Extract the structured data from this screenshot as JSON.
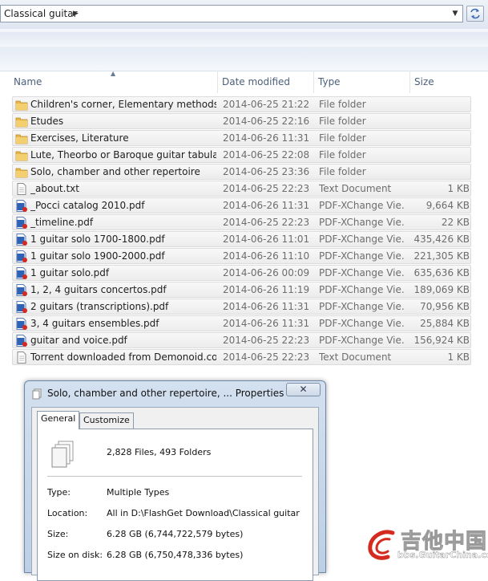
{
  "address_bar": {
    "path": "Classical guitar",
    "chevron_icon": "chevron-right-icon",
    "dropdown_icon": "chevron-down-icon",
    "refresh_icon": "refresh-icon"
  },
  "columns": {
    "name": "Name",
    "date_modified": "Date modified",
    "type": "Type",
    "size": "Size",
    "sorted_by": "Name"
  },
  "files": [
    {
      "name": "Children's corner, Elementary methods",
      "date": "2014-06-25 21:22",
      "type": "File folder",
      "size": "",
      "icon": "folder-icon"
    },
    {
      "name": "Etudes",
      "date": "2014-06-25 22:16",
      "type": "File folder",
      "size": "",
      "icon": "folder-icon"
    },
    {
      "name": "Exercises, Literature",
      "date": "2014-06-26 11:31",
      "type": "File folder",
      "size": "",
      "icon": "folder-icon"
    },
    {
      "name": "Lute, Theorbo or Baroque guitar tabulatu...",
      "date": "2014-06-25 22:08",
      "type": "File folder",
      "size": "",
      "icon": "folder-icon"
    },
    {
      "name": "Solo, chamber and other repertoire",
      "date": "2014-06-25 23:36",
      "type": "File folder",
      "size": "",
      "icon": "folder-icon"
    },
    {
      "name": "_about.txt",
      "date": "2014-06-25 22:23",
      "type": "Text Document",
      "size": "1 KB",
      "icon": "text-file-icon"
    },
    {
      "name": "_Pocci catalog 2010.pdf",
      "date": "2014-06-26 11:31",
      "type": "PDF-XChange Vie...",
      "size": "9,664 KB",
      "icon": "pdf-file-icon"
    },
    {
      "name": "_timeline.pdf",
      "date": "2014-06-25 22:23",
      "type": "PDF-XChange Vie...",
      "size": "22 KB",
      "icon": "pdf-file-icon"
    },
    {
      "name": "1 guitar solo 1700-1800.pdf",
      "date": "2014-06-26 11:01",
      "type": "PDF-XChange Vie...",
      "size": "435,426 KB",
      "icon": "pdf-file-icon"
    },
    {
      "name": "1 guitar solo 1900-2000.pdf",
      "date": "2014-06-26 11:10",
      "type": "PDF-XChange Vie...",
      "size": "221,305 KB",
      "icon": "pdf-file-icon"
    },
    {
      "name": "1 guitar solo.pdf",
      "date": "2014-06-26 00:09",
      "type": "PDF-XChange Vie...",
      "size": "635,636 KB",
      "icon": "pdf-file-icon"
    },
    {
      "name": "1, 2, 4 guitars concertos.pdf",
      "date": "2014-06-26 11:19",
      "type": "PDF-XChange Vie...",
      "size": "189,069 KB",
      "icon": "pdf-file-icon"
    },
    {
      "name": "2 guitars (transcriptions).pdf",
      "date": "2014-06-26 11:31",
      "type": "PDF-XChange Vie...",
      "size": "70,956 KB",
      "icon": "pdf-file-icon"
    },
    {
      "name": "3, 4 guitars ensembles.pdf",
      "date": "2014-06-26 11:31",
      "type": "PDF-XChange Vie...",
      "size": "25,884 KB",
      "icon": "pdf-file-icon"
    },
    {
      "name": "guitar and voice.pdf",
      "date": "2014-06-25 22:23",
      "type": "PDF-XChange Vie...",
      "size": "156,924 KB",
      "icon": "pdf-file-icon"
    },
    {
      "name": "Torrent downloaded from Demonoid.co...",
      "date": "2014-06-25 22:23",
      "type": "Text Document",
      "size": "1 KB",
      "icon": "text-file-icon"
    }
  ],
  "dialog": {
    "title": "Solo, chamber and other repertoire, ... Properties",
    "close_label": "✕",
    "tabs": [
      "General",
      "Customize"
    ],
    "active_tab": "General",
    "summary": "2,828 Files, 493 Folders",
    "summary_icon": "multiple-files-icon",
    "properties": [
      {
        "label": "Type:",
        "value": "Multiple Types"
      },
      {
        "label": "Location:",
        "value": "All in D:\\FlashGet Download\\Classical guitar"
      },
      {
        "label": "Size:",
        "value": "6.28 GB (6,744,722,579 bytes)"
      },
      {
        "label": "Size on disk:",
        "value": "6.28 GB (6,750,478,336 bytes)"
      }
    ]
  },
  "watermark": {
    "text": "吉他中国",
    "url": "bbs.GuitarChina.com",
    "logo_icon": "guitar-logo-icon"
  },
  "colors": {
    "header_text": "#4c607a",
    "row_bg": "#eeeeee",
    "folder": "#e8b84a",
    "pdf": "#2f62b5"
  }
}
